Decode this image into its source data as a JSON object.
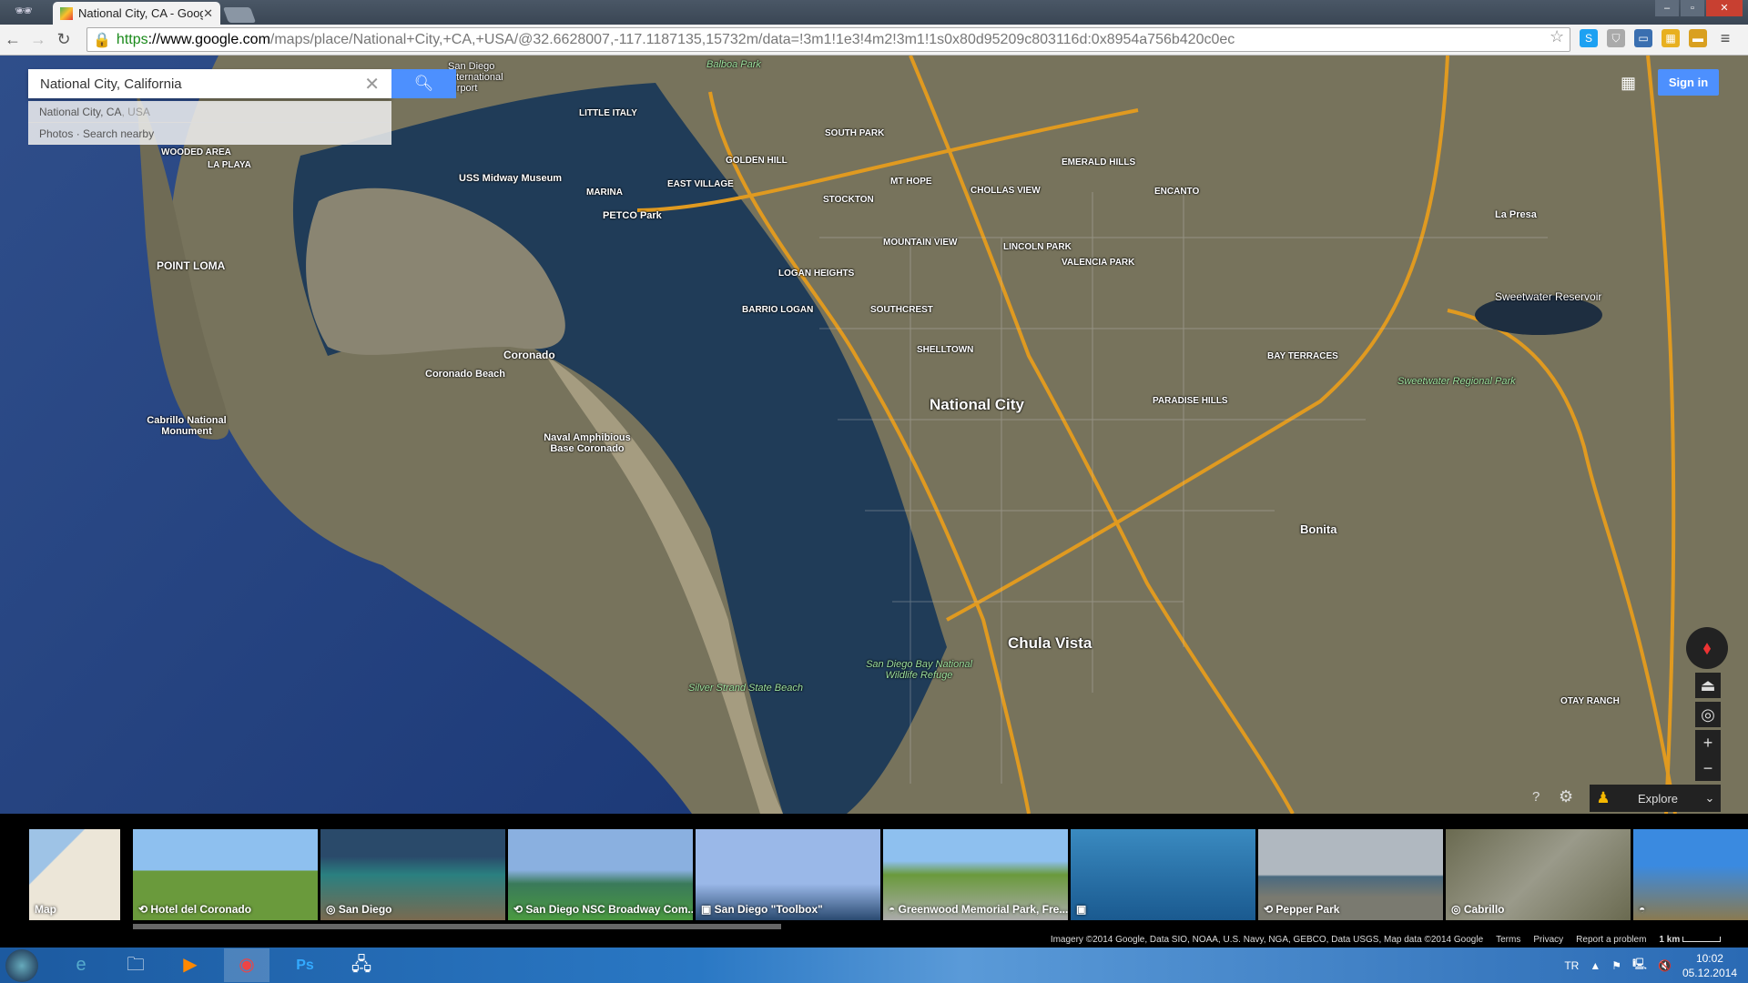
{
  "browser": {
    "tab_title": "National City, CA - Googl",
    "url_proto": "https",
    "url_host": "://www.google.com",
    "url_path": "/maps/place/National+City,+CA,+USA/@32.6628007,-117.1187135,15732m/data=!3m1!1e3!4m2!3m1!1s0x80d95209c803116d:0x8954a756b420c0ec"
  },
  "search": {
    "value": "National City, California",
    "suggestions": [
      {
        "main": "National City, CA",
        "sub": ", USA"
      },
      {
        "main": "Photos · Search nearby",
        "sub": ""
      }
    ]
  },
  "header": {
    "sign_in": "Sign in"
  },
  "map": {
    "labels": {
      "national_city": "National City",
      "chula_vista": "Chula Vista",
      "coronado": "Coronado",
      "coronado_beach": "Coronado Beach",
      "point_loma": "POINT LOMA",
      "cabrillo": "Cabrillo National Monument",
      "midway": "USS Midway Museum",
      "petco": "PETCO Park",
      "naval": "Naval Amphibious Base Coronado",
      "silver_strand": "Silver Strand State Beach",
      "refuge": "San Diego Bay National Wildlife Refuge",
      "sweetwater_res": "Sweetwater Reservoir",
      "sweetwater_park": "Sweetwater Regional Park",
      "bonita": "Bonita",
      "la_presa": "La Presa",
      "otay": "OTAY RANCH",
      "airport": "San Diego International Airport",
      "balboa": "Balboa Park",
      "logan": "LOGAN HEIGHTS",
      "barrio": "BARRIO LOGAN",
      "shelltown": "SHELLTOWN",
      "paradise": "PARADISE HILLS",
      "bay_terraces": "BAY TERRACES",
      "encanto": "ENCANTO",
      "emerald": "EMERALD HILLS",
      "valencia": "VALENCIA PARK",
      "lincoln": "LINCOLN PARK",
      "chollas": "CHOLLAS VIEW",
      "golden": "GOLDEN HILL",
      "south_park": "SOUTH PARK",
      "east_village": "EAST VILLAGE",
      "marina": "MARINA",
      "little_italy": "LITTLE ITALY",
      "la_playa": "LA PLAYA",
      "wooded": "WOODED AREA",
      "southcrest": "SOUTHCREST",
      "mt_hope": "MT HOPE",
      "stockton": "STOCKTON",
      "mountain_view": "MOUNTAIN VIEW"
    },
    "controls": {
      "explore": "Explore",
      "help": "?"
    }
  },
  "photos": [
    {
      "label": "Map",
      "icon": "map"
    },
    {
      "label": "Hotel del Coronado",
      "icon": "360"
    },
    {
      "label": "San Diego",
      "icon": "globe"
    },
    {
      "label": "San Diego NSC Broadway Com...",
      "icon": "360"
    },
    {
      "label": "San Diego \"Toolbox\"",
      "icon": "camera"
    },
    {
      "label": "Greenwood Memorial Park, Fre...",
      "icon": "pano"
    },
    {
      "label": "",
      "icon": "camera"
    },
    {
      "label": "Pepper Park",
      "icon": "360"
    },
    {
      "label": "Cabrillo",
      "icon": "globe"
    },
    {
      "label": "",
      "icon": "pano"
    }
  ],
  "footer": {
    "attribution": "Imagery ©2014 Google, Data SIO, NOAA, U.S. Navy, NGA, GEBCO, Data USGS, Map data ©2014 Google",
    "terms": "Terms",
    "privacy": "Privacy",
    "report": "Report a problem",
    "scale": "1 km"
  },
  "taskbar": {
    "lang": "TR",
    "time": "10:02",
    "date": "05.12.2014"
  }
}
